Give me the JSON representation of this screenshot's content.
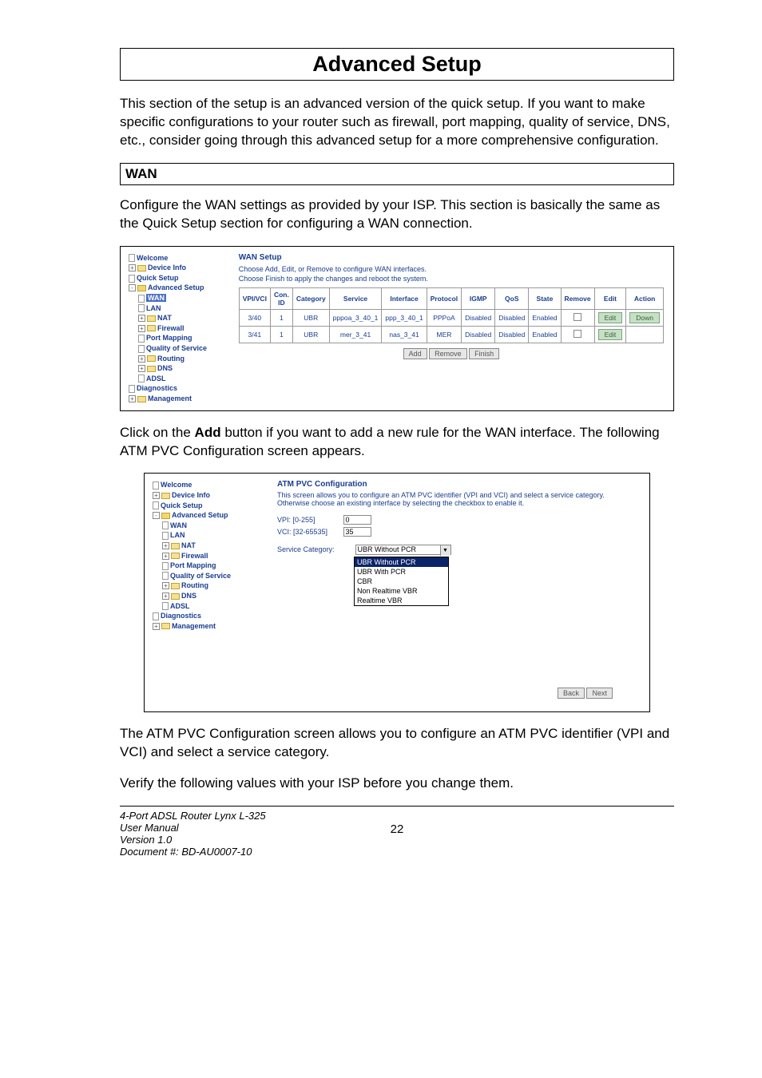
{
  "page_title": "Advanced Setup",
  "intro_para": "This section of the setup is an advanced version of the quick setup.  If you want to make specific configurations to your router such as firewall, port mapping, quality of service, DNS, etc., consider going through this advanced setup for a more comprehensive configuration.",
  "wan_heading": "WAN",
  "wan_para": "Configure the WAN settings as provided by your ISP.  This section is basically the same as the Quick Setup section for configuring a WAN connection.",
  "tree": {
    "welcome": "Welcome",
    "device_info": "Device Info",
    "quick_setup": "Quick Setup",
    "advanced_setup": "Advanced Setup",
    "wan": "WAN",
    "lan": "LAN",
    "nat": "NAT",
    "firewall": "Firewall",
    "port_mapping": "Port Mapping",
    "qos": "Quality of Service",
    "routing": "Routing",
    "dns": "DNS",
    "adsl": "ADSL",
    "diagnostics": "Diagnostics",
    "management": "Management"
  },
  "wan_setup": {
    "title": "WAN Setup",
    "line1": "Choose Add, Edit, or Remove to configure WAN interfaces.",
    "line2": "Choose Finish to apply the changes and reboot the system.",
    "headers": [
      "VPI/VCI",
      "Con. ID",
      "Category",
      "Service",
      "Interface",
      "Protocol",
      "IGMP",
      "QoS",
      "State",
      "Remove",
      "Edit",
      "Action"
    ],
    "rows": [
      {
        "vpi": "3/40",
        "con": "1",
        "cat": "UBR",
        "svc": "pppoa_3_40_1",
        "if": "ppp_3_40_1",
        "proto": "PPPoA",
        "igmp": "Disabled",
        "qos": "Disabled",
        "state": "Enabled",
        "edit": "Edit",
        "action": "Down"
      },
      {
        "vpi": "3/41",
        "con": "1",
        "cat": "UBR",
        "svc": "mer_3_41",
        "if": "nas_3_41",
        "proto": "MER",
        "igmp": "Disabled",
        "qos": "Disabled",
        "state": "Enabled",
        "edit": "Edit",
        "action": ""
      }
    ],
    "btn_add": "Add",
    "btn_remove": "Remove",
    "btn_finish": "Finish"
  },
  "mid_para_1": "Click on the ",
  "mid_para_bold": "Add",
  "mid_para_2": " button if you want to add a new rule for the WAN interface.  The following ATM PVC Configuration screen appears.",
  "atm": {
    "title": "ATM PVC Configuration",
    "desc": "This screen allows you to configure an ATM PVC identifier (VPI and VCI) and select a service category. Otherwise choose an existing interface by selecting the checkbox to enable it.",
    "vpi_label": "VPI: [0-255]",
    "vpi_val": "0",
    "vci_label": "VCI: [32-65535]",
    "vci_val": "35",
    "svc_label": "Service Category:",
    "svc_selected": "UBR Without PCR",
    "options": [
      "UBR Without PCR",
      "UBR With PCR",
      "CBR",
      "Non Realtime VBR",
      "Realtime VBR"
    ],
    "back": "Back",
    "next": "Next"
  },
  "post_para1": "The ATM PVC Configuration screen allows you to configure an ATM PVC identifier (VPI and VCI) and select a service category.",
  "post_para2": "Verify the following values with your ISP before you change them.",
  "footer": {
    "line1": "4-Port ADSL Router Lynx L-325",
    "line2": "User Manual",
    "line3": "Version 1.0",
    "line4": "Document #:  BD-AU0007-10",
    "page": "22"
  }
}
